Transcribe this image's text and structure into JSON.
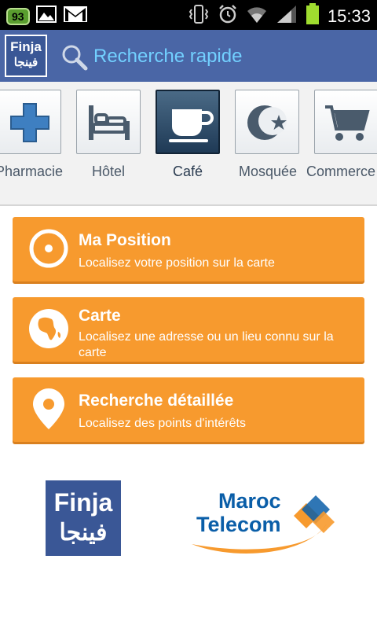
{
  "status": {
    "battery_badge": "93",
    "time": "15:33"
  },
  "header": {
    "logo_latin": "Finja",
    "logo_arabic": "فينجا",
    "search_text": "Recherche rapide"
  },
  "categories": [
    {
      "label": "Pharmacie",
      "icon": "pharmacy-cross-icon",
      "selected": false
    },
    {
      "label": "Hôtel",
      "icon": "bed-icon",
      "selected": false
    },
    {
      "label": "Café",
      "icon": "coffee-cup-icon",
      "selected": true
    },
    {
      "label": "Mosquée",
      "icon": "crescent-star-icon",
      "selected": false
    },
    {
      "label": "Commerce",
      "icon": "shopping-cart-icon",
      "selected": false
    }
  ],
  "menu": [
    {
      "title": "Ma Position",
      "subtitle": "Localisez votre position sur la carte",
      "icon": "target-icon"
    },
    {
      "title": "Carte",
      "subtitle": "Localisez une adresse ou un lieu connu sur la carte",
      "icon": "globe-icon"
    },
    {
      "title": "Recherche détaillée",
      "subtitle": "Localisez des points d'intérêts",
      "icon": "map-pin-icon"
    }
  ],
  "footer": {
    "finja_latin": "Finja",
    "finja_arabic": "فينجا",
    "partner_line1": "Maroc",
    "partner_line2": "Telecom"
  },
  "colors": {
    "accent": "#f79a2e",
    "appbar": "#4a66a6",
    "search_text": "#72d0ff"
  }
}
